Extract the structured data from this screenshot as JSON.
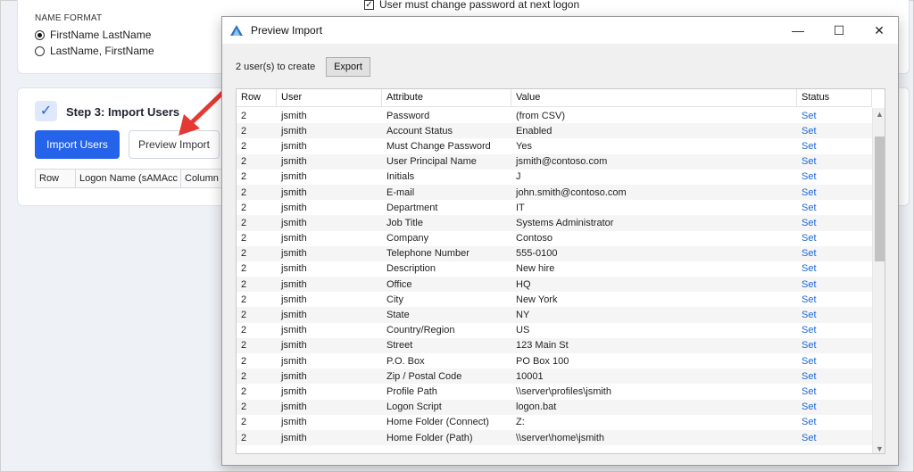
{
  "background": {
    "name_format_label": "NAME FORMAT",
    "name_options": [
      {
        "label": "FirstName LastName",
        "selected": true
      },
      {
        "label": "LastName, FirstName",
        "selected": false
      }
    ],
    "checkbox_label": "User must change password at next logon",
    "step_title": "Step 3: Import Users",
    "import_button": "Import Users",
    "preview_button": "Preview Import",
    "table_headers": [
      "Row",
      "Logon Name (sAMAcc",
      "Column"
    ]
  },
  "dialog": {
    "title": "Preview Import",
    "users_count": "2 user(s) to create",
    "export_label": "Export",
    "minimize_glyph": "—",
    "maximize_glyph": "☐",
    "close_glyph": "✕",
    "columns": [
      "Row",
      "User",
      "Attribute",
      "Value",
      "Status"
    ],
    "rows": [
      [
        "2",
        "jsmith",
        "Password",
        "(from CSV)",
        "Set"
      ],
      [
        "2",
        "jsmith",
        "Account Status",
        "Enabled",
        "Set"
      ],
      [
        "2",
        "jsmith",
        "Must Change Password",
        "Yes",
        "Set"
      ],
      [
        "2",
        "jsmith",
        "User Principal Name",
        "jsmith@contoso.com",
        "Set"
      ],
      [
        "2",
        "jsmith",
        "Initials",
        "J",
        "Set"
      ],
      [
        "2",
        "jsmith",
        "E-mail",
        "john.smith@contoso.com",
        "Set"
      ],
      [
        "2",
        "jsmith",
        "Department",
        "IT",
        "Set"
      ],
      [
        "2",
        "jsmith",
        "Job Title",
        "Systems Administrator",
        "Set"
      ],
      [
        "2",
        "jsmith",
        "Company",
        "Contoso",
        "Set"
      ],
      [
        "2",
        "jsmith",
        "Telephone Number",
        "555-0100",
        "Set"
      ],
      [
        "2",
        "jsmith",
        "Description",
        "New hire",
        "Set"
      ],
      [
        "2",
        "jsmith",
        "Office",
        "HQ",
        "Set"
      ],
      [
        "2",
        "jsmith",
        "City",
        "New York",
        "Set"
      ],
      [
        "2",
        "jsmith",
        "State",
        "NY",
        "Set"
      ],
      [
        "2",
        "jsmith",
        "Country/Region",
        "US",
        "Set"
      ],
      [
        "2",
        "jsmith",
        "Street",
        "123 Main St",
        "Set"
      ],
      [
        "2",
        "jsmith",
        "P.O. Box",
        "PO Box 100",
        "Set"
      ],
      [
        "2",
        "jsmith",
        "Zip / Postal Code",
        "10001",
        "Set"
      ],
      [
        "2",
        "jsmith",
        "Profile Path",
        "\\\\server\\profiles\\jsmith",
        "Set"
      ],
      [
        "2",
        "jsmith",
        "Logon Script",
        "logon.bat",
        "Set"
      ],
      [
        "2",
        "jsmith",
        "Home Folder (Connect)",
        "Z:",
        "Set"
      ],
      [
        "2",
        "jsmith",
        "Home Folder (Path)",
        "\\\\server\\home\\jsmith",
        "Set"
      ]
    ]
  },
  "colors": {
    "accent": "#2563eb",
    "status_link": "#1a66d6",
    "arrow": "#e53935"
  }
}
